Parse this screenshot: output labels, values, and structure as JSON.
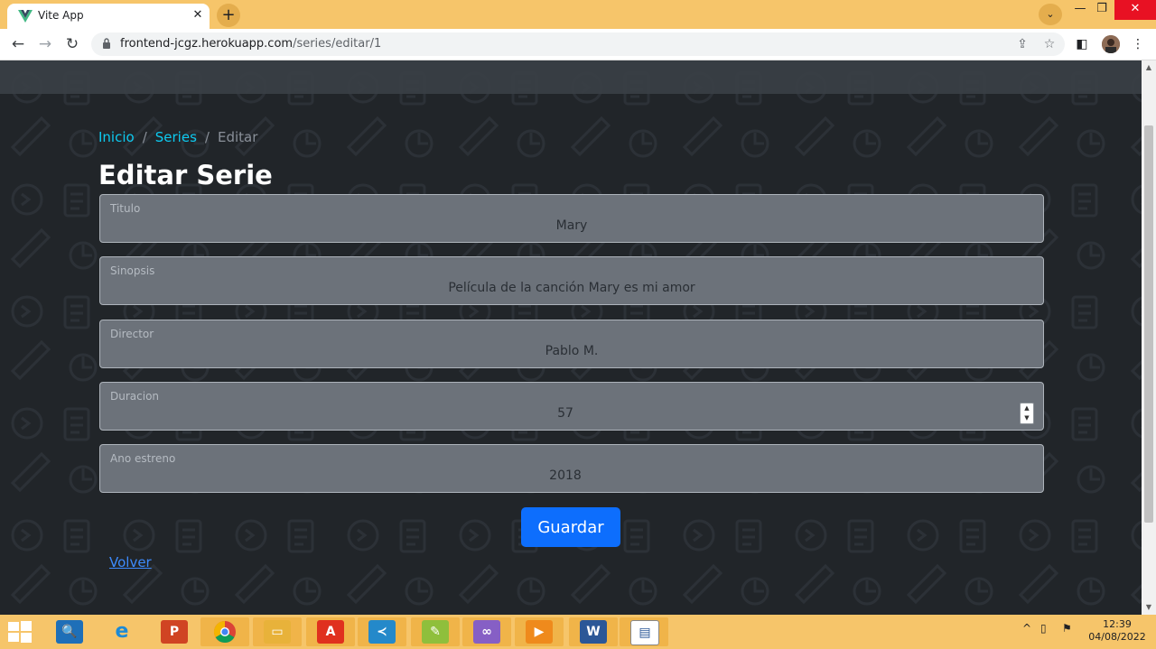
{
  "browser": {
    "tab_title": "Vite App",
    "tab_close": "✕",
    "new_tab": "+",
    "url_host": "frontend-jcgz.herokuapp.com",
    "url_path": "/series/editar/1",
    "controls": {
      "minimize": "—",
      "restore": "❐",
      "close": "✕"
    }
  },
  "breadcrumb": {
    "home": "Inicio",
    "series": "Series",
    "current": "Editar",
    "separator": "/"
  },
  "page": {
    "title": "Editar Serie"
  },
  "form": {
    "fields": [
      {
        "label": "Titulo",
        "value": "Mary"
      },
      {
        "label": "Sinopsis",
        "value": "Película de la canción Mary es mi amor"
      },
      {
        "label": "Director",
        "value": "Pablo M."
      },
      {
        "label": "Duracion",
        "value": "57"
      },
      {
        "label": "Ano estreno",
        "value": "2018"
      }
    ],
    "submit_label": "Guardar",
    "back_label": "Volver"
  },
  "taskbar": {
    "apps": [
      "search-app",
      "internet-explorer",
      "powerpoint",
      "chrome",
      "file-explorer",
      "pdf-reader",
      "vscode",
      "notepad-plus-plus",
      "visual-studio",
      "media-player",
      "word",
      "web-app"
    ],
    "clock_time": "12:39",
    "clock_date": "04/08/2022"
  },
  "colors": {
    "accent": "#0d6efd",
    "link": "#0dcaf0",
    "taskbar": "#f6c56a",
    "page_bg": "#212529"
  }
}
